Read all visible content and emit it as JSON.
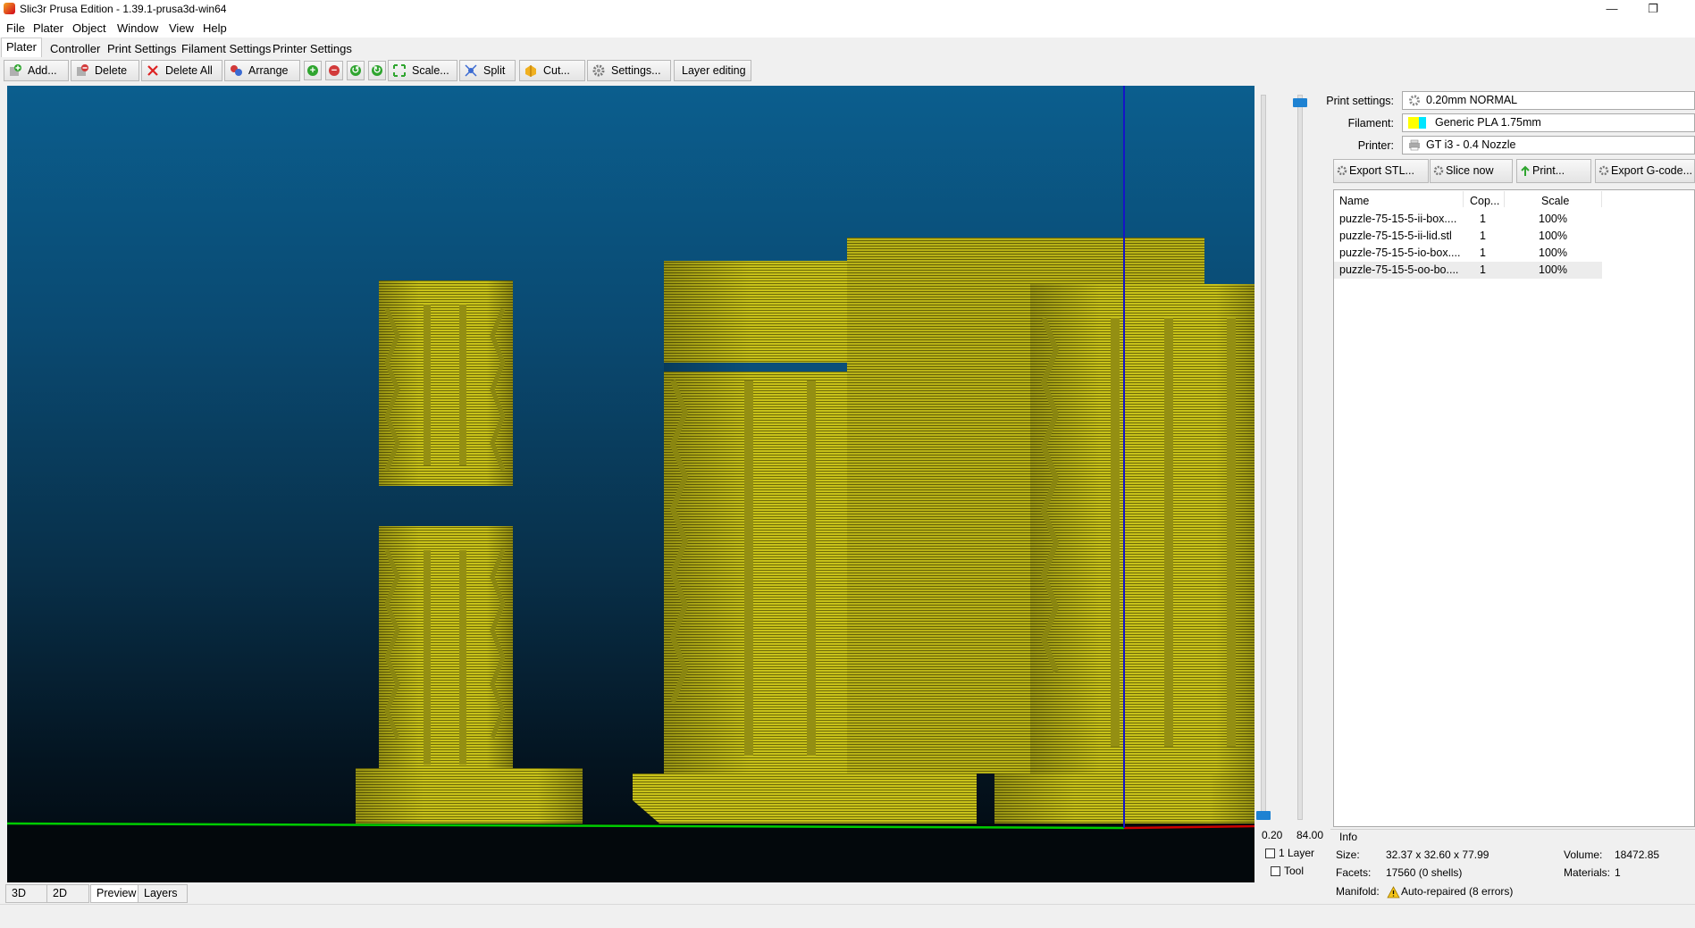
{
  "window": {
    "title": "Slic3r Prusa Edition - 1.39.1-prusa3d-win64",
    "controls": [
      "—",
      "❐",
      "✕"
    ]
  },
  "menu": [
    "File",
    "Plater",
    "Object",
    "Window",
    "View",
    "Help"
  ],
  "tabs": [
    "Plater",
    "Controller",
    "Print Settings",
    "Filament Settings",
    "Printer Settings"
  ],
  "toolbar": {
    "add": "Add...",
    "delete": "Delete",
    "delete_all": "Delete All",
    "arrange": "Arrange",
    "scale": "Scale...",
    "split": "Split",
    "cut": "Cut...",
    "settings": "Settings...",
    "layer_editing": "Layer editing"
  },
  "layer_slider": {
    "min": "0.20",
    "max": "84.00",
    "one_layer_label": "1 Layer",
    "tool_label": "Tool"
  },
  "view_tabs": [
    "3D",
    "2D",
    "Preview",
    "Layers"
  ],
  "presets": {
    "print_label": "Print settings:",
    "print_value": "0.20mm NORMAL",
    "filament_label": "Filament:",
    "filament_value": "Generic PLA 1.75mm",
    "filament_color": "#ffff00",
    "filament_swatch_2": "#00e5ff",
    "printer_label": "Printer:",
    "printer_value": "GT i3 - 0.4 Nozzle"
  },
  "actions": {
    "export_stl": "Export STL...",
    "slice_now": "Slice now",
    "print": "Print...",
    "export_gcode": "Export G-code..."
  },
  "object_list": {
    "columns": [
      "Name",
      "Cop...",
      "Scale"
    ],
    "rows": [
      {
        "name": "puzzle-75-15-5-ii-box....",
        "copies": "1",
        "scale": "100%"
      },
      {
        "name": "puzzle-75-15-5-ii-lid.stl",
        "copies": "1",
        "scale": "100%"
      },
      {
        "name": "puzzle-75-15-5-io-box....",
        "copies": "1",
        "scale": "100%"
      },
      {
        "name": "puzzle-75-15-5-oo-bo....",
        "copies": "1",
        "scale": "100%"
      }
    ]
  },
  "info": {
    "title": "Info",
    "size_label": "Size:",
    "size_value": "32.37 x 32.60 x 77.99",
    "volume_label": "Volume:",
    "volume_value": "18472.85",
    "facets_label": "Facets:",
    "facets_value": "17560 (0 shells)",
    "materials_label": "Materials:",
    "materials_value": "1",
    "manifold_label": "Manifold:",
    "manifold_value": "Auto-repaired (8 errors)"
  },
  "colors": {
    "model_yellow": "#c8c21a",
    "slider_blue": "#1e82d2",
    "axis_green": "#00cc00",
    "axis_red": "#cc0000",
    "axis_blue": "#1414c8"
  }
}
